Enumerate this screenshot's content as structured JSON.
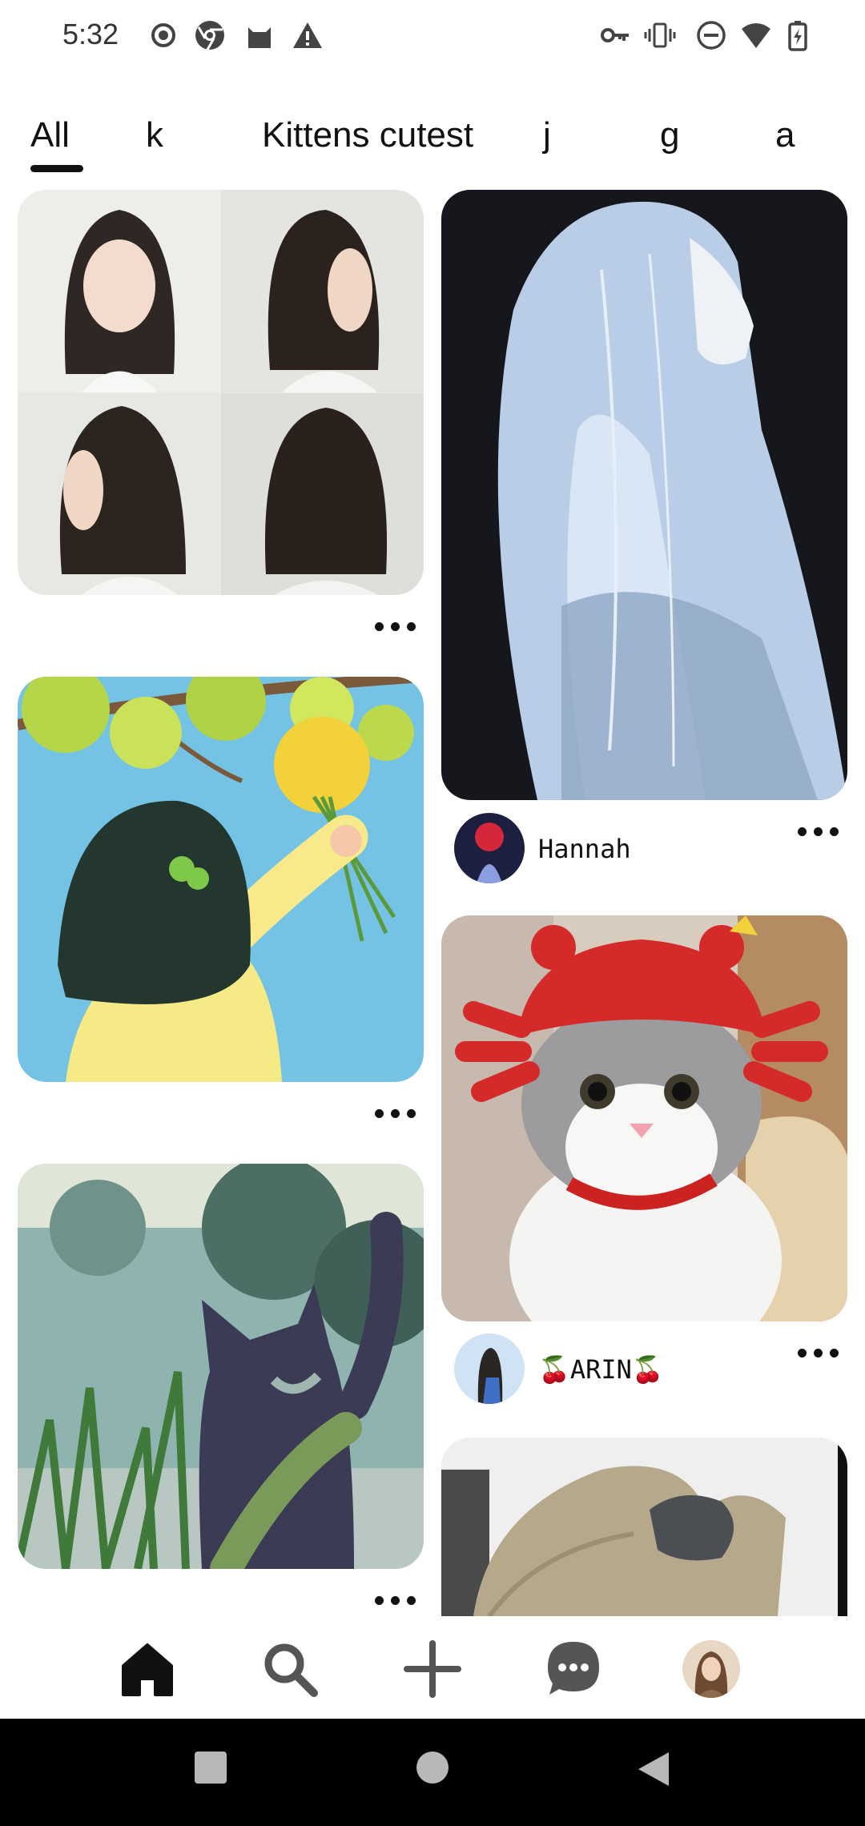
{
  "status_bar": {
    "time": "5:32",
    "left_icons": [
      "record-icon",
      "chrome-icon",
      "cat-app-icon",
      "warning-icon"
    ],
    "right_icons": [
      "vpn-key-icon",
      "vibrate-icon",
      "do-not-disturb-icon",
      "wifi-icon",
      "battery-charging-icon"
    ]
  },
  "tabs": {
    "items": [
      "All",
      "k",
      "Kittens cutest",
      "j",
      "g",
      "a"
    ],
    "selected": "All"
  },
  "feed": {
    "left_column": [
      {
        "image": "hairstyle-collage-image",
        "has_author": false
      },
      {
        "image": "girl-holding-flowers-illustration",
        "has_author": false
      },
      {
        "image": "black-cat-illustration",
        "has_author": false
      }
    ],
    "right_column": [
      {
        "image": "silver-hair-anime-portrait",
        "author": "Hannah"
      },
      {
        "image": "cat-in-crab-hat-photo",
        "author": "🍒ARIN🍒"
      },
      {
        "image": "hair-scrunchie-photo",
        "author": ""
      }
    ]
  },
  "bottom_nav": {
    "items": [
      "home-icon",
      "search-icon",
      "create-plus-icon",
      "messages-icon",
      "profile-avatar"
    ],
    "active": "home-icon"
  },
  "system_nav": [
    "recents-square-icon",
    "home-circle-icon",
    "back-triangle-icon"
  ],
  "colors": {
    "background": "#ffffff",
    "text": "#111111",
    "system_bar": "#000000"
  }
}
